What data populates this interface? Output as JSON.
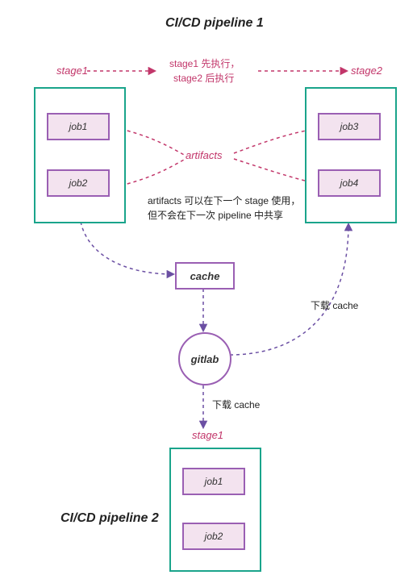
{
  "title_p1": "CI/CD pipeline 1",
  "title_p2": "CI/CD pipeline 2",
  "stage1_label": "stage1",
  "stage2_label": "stage2",
  "pipeline2_stage1_label": "stage1",
  "order_note_line1": "stage1 先执行，",
  "order_note_line2": "stage2 后执行",
  "artifacts_label": "artifacts",
  "artifacts_note_line1": "artifacts 可以在下一个 stage 使用，",
  "artifacts_note_line2": "但不会在下一次 pipeline 中共享",
  "cache_label": "cache",
  "gitlab_label": "gitlab",
  "download_cache_1": "下载 cache",
  "download_cache_2": "下载 cache",
  "jobs_p1_stage1": {
    "job1": "job1",
    "job2": "job2"
  },
  "jobs_p1_stage2": {
    "job3": "job3",
    "job4": "job4"
  },
  "jobs_p2_stage1": {
    "job1": "job1",
    "job2": "job2"
  }
}
